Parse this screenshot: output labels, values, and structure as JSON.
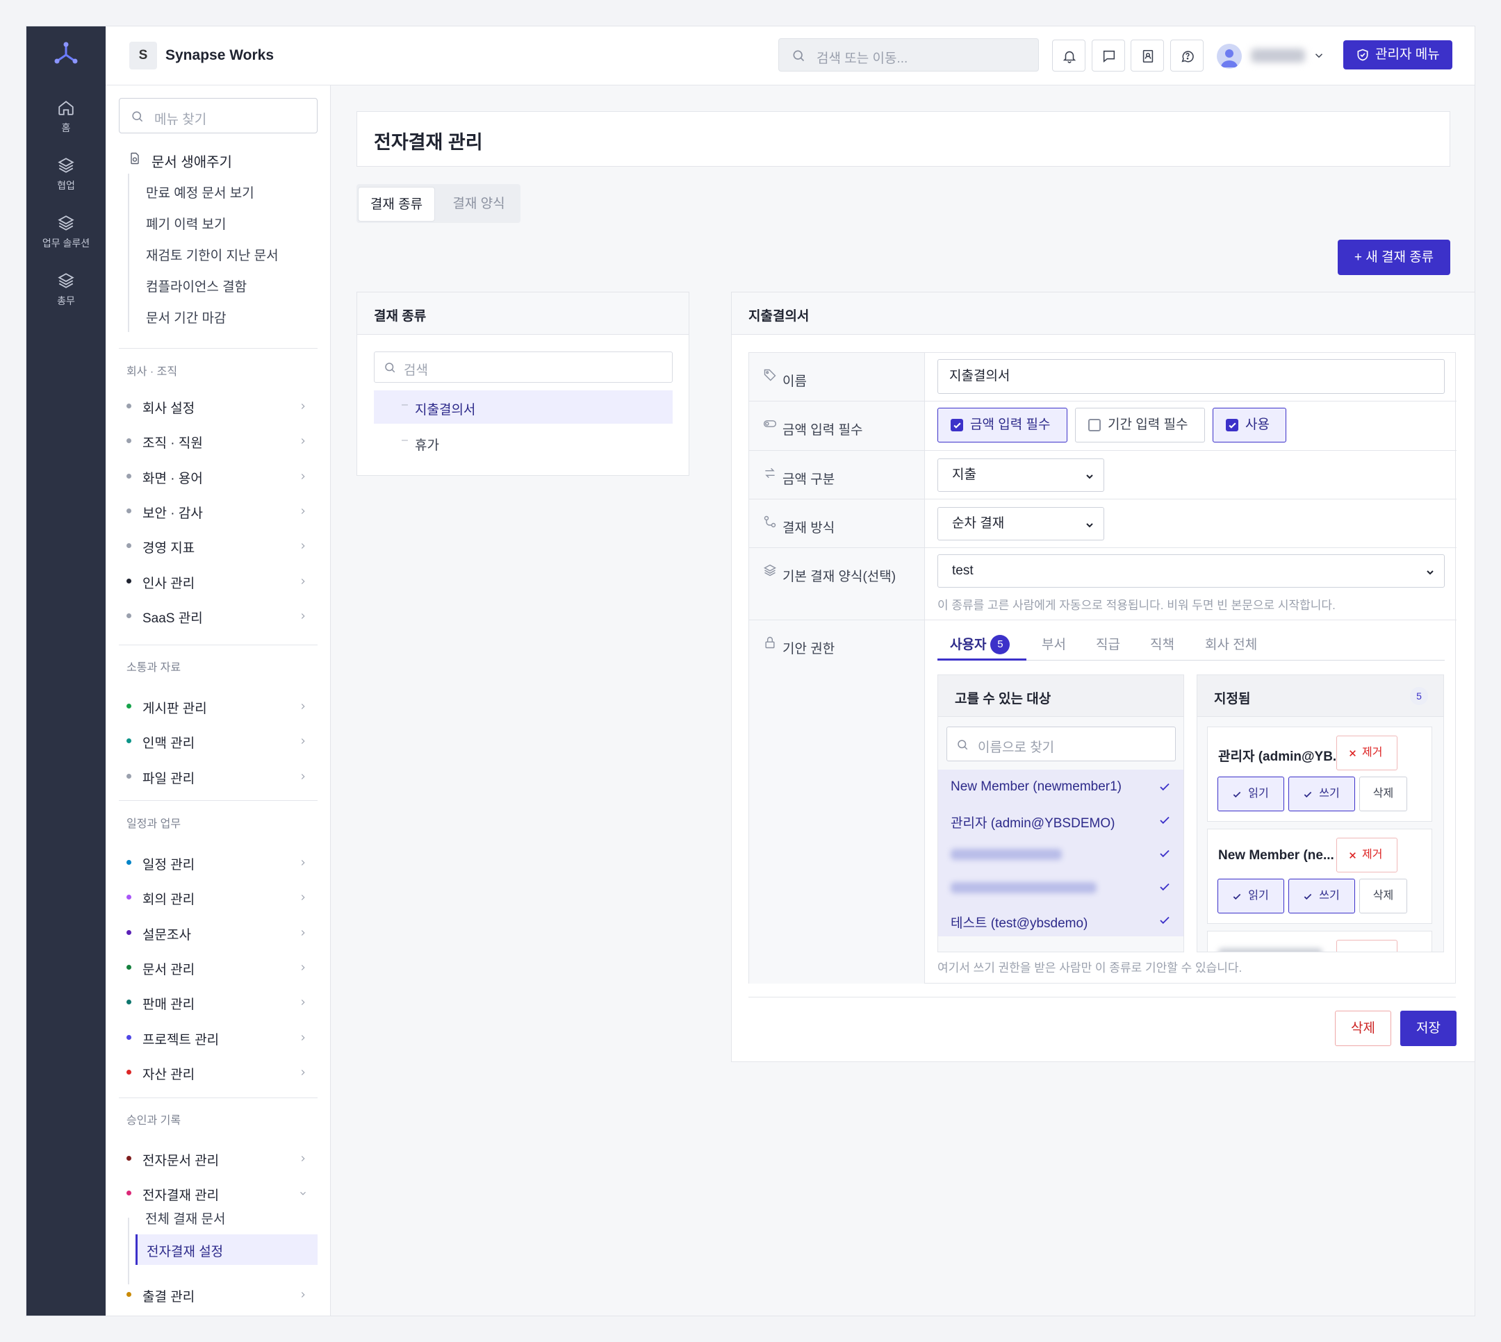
{
  "rail": {
    "items": [
      {
        "label": "홈",
        "icon": "home-icon"
      },
      {
        "label": "협업",
        "icon": "layers-icon"
      },
      {
        "label": "업무 솔루션",
        "icon": "layers-icon"
      },
      {
        "label": "총무",
        "icon": "layers-icon"
      }
    ]
  },
  "header": {
    "workspace_initial": "S",
    "workspace_name": "Synapse Works",
    "search_placeholder": "검색 또는 이동...",
    "admin_menu_label": "관리자 메뉴"
  },
  "sidebar": {
    "search_placeholder": "메뉴 찾기",
    "lifecycle": {
      "title": "문서 생애주기",
      "items": [
        "만료 예정 문서 보기",
        "폐기 이력 보기",
        "재검토 기한이 지난 문서",
        "컴플라이언스 결함",
        "문서 기간 마감"
      ]
    },
    "sections": [
      {
        "title": "회사 · 조직",
        "items": [
          {
            "label": "회사 설정",
            "color": "#9aa0ad"
          },
          {
            "label": "조직 · 직원",
            "color": "#9aa0ad"
          },
          {
            "label": "화면 · 용어",
            "color": "#9aa0ad"
          },
          {
            "label": "보안 · 감사",
            "color": "#9aa0ad"
          },
          {
            "label": "경영 지표",
            "color": "#9aa0ad"
          },
          {
            "label": "인사 관리",
            "color": "#1f2330"
          },
          {
            "label": "SaaS 관리",
            "color": "#9aa0ad"
          }
        ]
      },
      {
        "title": "소통과 자료",
        "items": [
          {
            "label": "게시판 관리",
            "color": "#16a34a"
          },
          {
            "label": "인맥 관리",
            "color": "#0d9488"
          },
          {
            "label": "파일 관리",
            "color": "#9aa0ad"
          }
        ]
      },
      {
        "title": "일정과 업무",
        "items": [
          {
            "label": "일정 관리",
            "color": "#0284c7"
          },
          {
            "label": "회의 관리",
            "color": "#a855f7"
          },
          {
            "label": "설문조사",
            "color": "#5b21b6"
          },
          {
            "label": "문서 관리",
            "color": "#15803d"
          },
          {
            "label": "판매 관리",
            "color": "#0f766e"
          },
          {
            "label": "프로젝트 관리",
            "color": "#4f46e5"
          },
          {
            "label": "자산 관리",
            "color": "#dc2626"
          }
        ]
      },
      {
        "title": "승인과 기록",
        "items": [
          {
            "label": "전자문서 관리",
            "color": "#7f1d1d"
          },
          {
            "label": "전자결재 관리",
            "color": "#db2777"
          }
        ],
        "subitems": [
          "전체 결재 문서",
          "전자결재 설정"
        ],
        "last_item": {
          "label": "출결 관리",
          "color": "#ca8a04"
        }
      }
    ]
  },
  "main": {
    "title": "전자결재 관리",
    "tabs": [
      "결재 종류",
      "결재 양식"
    ],
    "new_button": "+ 새 결재 종류",
    "left_panel": {
      "title": "결재 종류",
      "search_placeholder": "검색",
      "items": [
        "지출결의서",
        "휴가"
      ]
    },
    "right_panel": {
      "title": "지출결의서",
      "fields": {
        "name_label": "이름",
        "name_value": "지출결의서",
        "amount_required_label": "금액 입력 필수",
        "checks": [
          {
            "label": "금액 입력 필수",
            "checked": true
          },
          {
            "label": "기간 입력 필수",
            "checked": false
          },
          {
            "label": "사용",
            "checked": true
          }
        ],
        "amount_type_label": "금액 구분",
        "amount_type_value": "지출",
        "approval_method_label": "결재 방식",
        "approval_method_value": "순차 결재",
        "default_form_label": "기본 결재 양식(선택)",
        "default_form_value": "test",
        "default_form_hint": "이 종류를 고른 사람에게 자동으로 적용됩니다. 비워 두면 빈 본문으로 시작합니다.",
        "draft_permission_label": "기안 권한",
        "permission_hint": "여기서 쓰기 권한을 받은 사람만 이 종류로 기안할 수 있습니다."
      },
      "subtabs": [
        "사용자",
        "부서",
        "직급",
        "직책",
        "회사 전체"
      ],
      "user_count": "5",
      "candidates": {
        "title": "고를 수 있는 대상",
        "search_placeholder": "이름으로 찾기",
        "items": [
          "New Member (newmember1)",
          "관리자 (admin@YBSDEMO)",
          "",
          "",
          "테스트 (test@ybsdemo)"
        ]
      },
      "assigned": {
        "title": "지정됨",
        "count": "5",
        "items": [
          {
            "name": "관리자 (admin@YB...",
            "remove": "제거",
            "read": "읽기",
            "write": "쓰기",
            "delete": "삭제"
          },
          {
            "name": "New Member (ne...",
            "remove": "제거",
            "read": "읽기",
            "write": "쓰기",
            "delete": "삭제"
          }
        ]
      },
      "delete_button": "삭제",
      "save_button": "저장"
    }
  }
}
